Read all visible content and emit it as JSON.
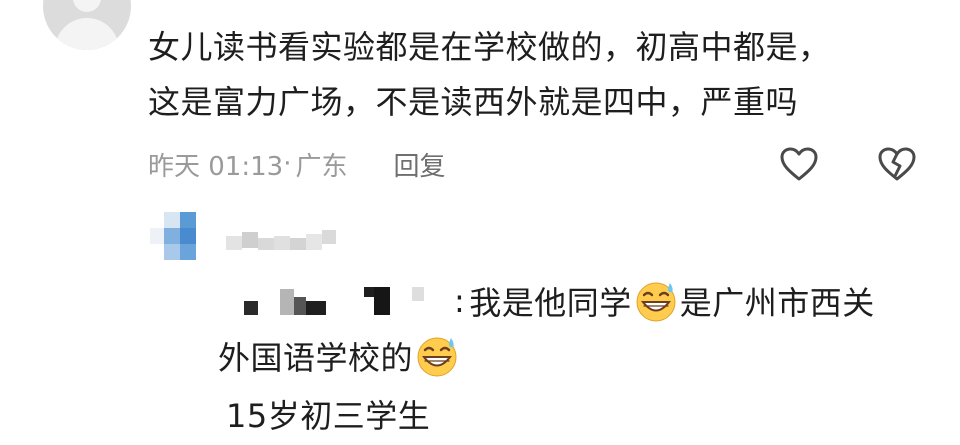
{
  "comment": {
    "line1": "女儿读书看实验都是在学校做的，初高中都是，",
    "line2": "这是富力广场，不是读西外就是四中，严重吗",
    "timestamp": "昨天 01:13",
    "location_sep": "·",
    "location": "广东",
    "reply_label": "回复",
    "like_icon": "heart-outline-icon",
    "dislike_icon": "broken-heart-icon"
  },
  "reply": {
    "colon": ":",
    "text_part1": "我是他同学",
    "emoji_name": "grinning-sweat-emoji",
    "text_part2": "是广州市西关",
    "line2_text": "外国语学校的",
    "line3_text": "15岁初三学生"
  },
  "colors": {
    "text": "#1e1e1e",
    "meta": "#9a9a9a",
    "reply_accent": "#6f6f6f",
    "avatar_blue": "#5b9bd5"
  }
}
